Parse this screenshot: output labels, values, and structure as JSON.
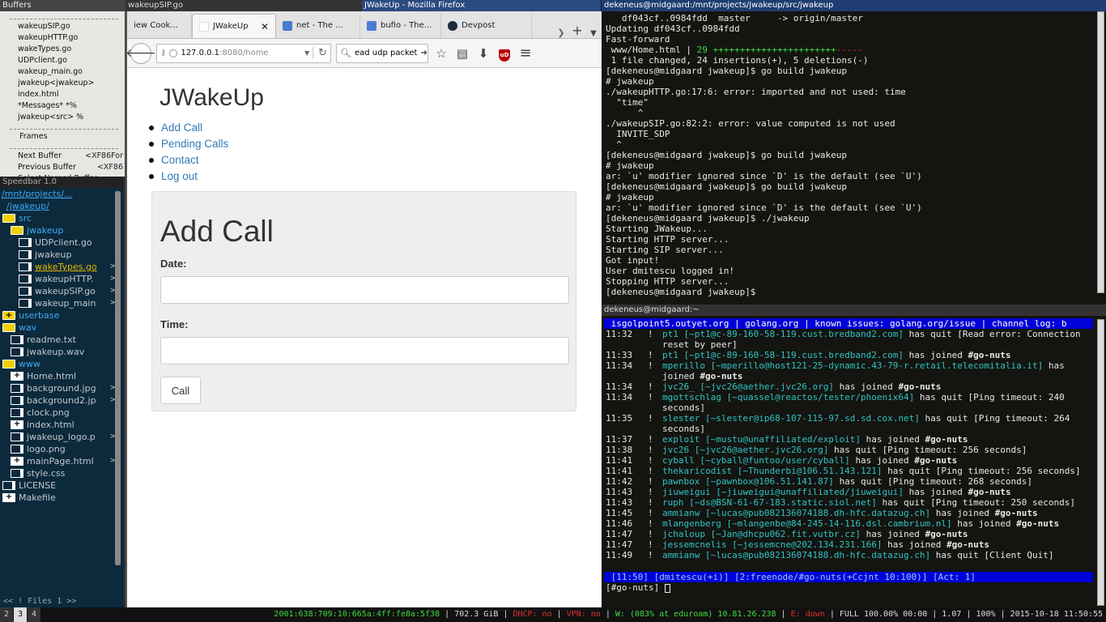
{
  "buffers": {
    "title": "Buffers",
    "items": [
      "wakeupSIP.go",
      "wakeupHTTP.go",
      "wakeTypes.go",
      "UDPclient.go",
      "wakeup_main.go",
      "jwakeup<jwakeup>",
      "index.html",
      "*Messages* *%",
      "jwakeup<src> %"
    ],
    "frames_label": "Frames",
    "commands": [
      {
        "label": "Next Buffer",
        "key": "<XF86For"
      },
      {
        "label": "Previous Buffer",
        "key": "<XF86"
      },
      {
        "label": "Select Named Buffer",
        "key": ""
      }
    ]
  },
  "speedbar": {
    "title": "Speedbar 1.0",
    "path1": "/mnt/projects/...",
    "path2": "/jwakeup/",
    "rows": [
      {
        "indent": 0,
        "icon": "folder",
        "label": "src",
        "cls": "dir"
      },
      {
        "indent": 1,
        "icon": "folder",
        "label": "jwakeup",
        "cls": "dir"
      },
      {
        "indent": 2,
        "icon": "file",
        "label": "UDPclient.go",
        "cls": ""
      },
      {
        "indent": 2,
        "icon": "file",
        "label": "jwakeup",
        "cls": ""
      },
      {
        "indent": 2,
        "icon": "file",
        "label": "wakeTypes.go",
        "cls": "sel",
        "arrow": ">"
      },
      {
        "indent": 2,
        "icon": "file",
        "label": "wakeupHTTP.",
        "cls": "",
        "arrow": ">"
      },
      {
        "indent": 2,
        "icon": "file",
        "label": "wakeupSIP.go",
        "cls": "",
        "arrow": ">"
      },
      {
        "indent": 2,
        "icon": "file",
        "label": "wakeup_main",
        "cls": "",
        "arrow": ">"
      },
      {
        "indent": 0,
        "icon": "folderplus",
        "label": "userbase",
        "cls": "dir"
      },
      {
        "indent": 0,
        "icon": "folder",
        "label": "wav",
        "cls": "dir"
      },
      {
        "indent": 1,
        "icon": "file",
        "label": "readme.txt",
        "cls": ""
      },
      {
        "indent": 1,
        "icon": "file",
        "label": "jwakeup.wav",
        "cls": ""
      },
      {
        "indent": 0,
        "icon": "folder",
        "label": "www",
        "cls": "dir"
      },
      {
        "indent": 1,
        "icon": "fileplus",
        "label": "Home.html",
        "cls": ""
      },
      {
        "indent": 1,
        "icon": "file",
        "label": "background.jpg",
        "cls": "",
        "arrow": ">"
      },
      {
        "indent": 1,
        "icon": "file",
        "label": "background2.jp",
        "cls": "",
        "arrow": ">"
      },
      {
        "indent": 1,
        "icon": "file",
        "label": "clock.png",
        "cls": ""
      },
      {
        "indent": 1,
        "icon": "fileplus",
        "label": "index.html",
        "cls": ""
      },
      {
        "indent": 1,
        "icon": "file",
        "label": "jwakeup_logo.p",
        "cls": "",
        "arrow": ">"
      },
      {
        "indent": 1,
        "icon": "file",
        "label": "logo.png",
        "cls": ""
      },
      {
        "indent": 1,
        "icon": "fileplus",
        "label": "mainPage.html",
        "cls": "",
        "arrow": ">"
      },
      {
        "indent": 1,
        "icon": "file",
        "label": "style.css",
        "cls": ""
      },
      {
        "indent": 0,
        "icon": "file",
        "label": "LICENSE",
        "cls": ""
      },
      {
        "indent": 0,
        "icon": "fileplus",
        "label": "Makefile",
        "cls": ""
      }
    ],
    "footer": "<< ! Files   1 >>"
  },
  "firefox": {
    "left_title": "wakeupSIP.go",
    "window_title": "JWakeUp - Mozilla Firefox",
    "tabs": [
      {
        "label": "iew Cook..."
      },
      {
        "label": "JWakeUp",
        "active": true
      },
      {
        "label": "net - The ..."
      },
      {
        "label": "bufio - The..."
      },
      {
        "label": "Devpost"
      }
    ],
    "url_host": "127.0.0.1",
    "url_rest": ":8080/home",
    "search_value": "ead udp packet",
    "page": {
      "brand": "JWakeUp",
      "nav": [
        "Add Call",
        "Pending Calls",
        "Contact",
        "Log out"
      ],
      "form_title": "Add Call",
      "date_label": "Date:",
      "time_label": "Time:",
      "date_value": "",
      "time_value": "",
      "submit": "Call"
    }
  },
  "term1": {
    "title": "dekeneus@midgaard:/mnt/projects/jwakeup/src/jwakeup",
    "lines": [
      "   df043cf..0984fdd  master     -> origin/master",
      "Updating df043cf..0984fdd",
      "Fast-forward",
      " www/Home.html | 29 +++++++++++++++++++++++-----",
      " 1 file changed, 24 insertions(+), 5 deletions(-)",
      "[dekeneus@midgaard jwakeup]$ go build jwakeup",
      "# jwakeup",
      "./wakeupHTTP.go:17:6: error: imported and not used: time",
      "  \"time\"",
      "      ^",
      "./wakeupSIP.go:82:2: error: value computed is not used",
      "  INVITE_SDP",
      "  ^",
      "[dekeneus@midgaard jwakeup]$ go build jwakeup",
      "# jwakeup",
      "ar: `u' modifier ignored since `D' is the default (see `U')",
      "[dekeneus@midgaard jwakeup]$ go build jwakeup",
      "# jwakeup",
      "ar: `u' modifier ignored since `D' is the default (see `U')",
      "[dekeneus@midgaard jwakeup]$ ./jwakeup",
      "Starting JWakeup...",
      "Starting HTTP server...",
      "Starting SIP server...",
      "Got input!",
      "User dmitescu logged in!",
      "Stopping HTTP server...",
      "[dekeneus@midgaard jwakeup]$ "
    ]
  },
  "term2": {
    "title": "dekeneus@midgaard:~",
    "topic": " isgolpoint5.outyet.org | golang.org | known issues: golang.org/issue | channel log: b",
    "lines": [
      {
        "t": "11:32",
        "nick": "pt1",
        "host": "[~pt1@c-89-160-58-119.cust.bredband2.com]",
        "action": "has quit",
        "extra": "[Read error: Connection reset by peer]"
      },
      {
        "t": "11:33",
        "nick": "pt1",
        "host": "[~pt1@c-89-160-58-119.cust.bredband2.com]",
        "action": "has joined",
        "extra": "#go-nuts"
      },
      {
        "t": "11:34",
        "nick": "mperillo",
        "host": "[~mperillo@host121-25-dynamic.43-79-r.retail.telecomitalia.it]",
        "action": "has joined",
        "extra": "#go-nuts"
      },
      {
        "t": "11:34",
        "nick": "jvc26_",
        "host": "[~jvc26@aether.jvc26.org]",
        "action": "has joined",
        "extra": "#go-nuts"
      },
      {
        "t": "11:34",
        "nick": "mgottschlag",
        "host": "[~quassel@reactos/tester/phoenix64]",
        "action": "has quit",
        "extra": "[Ping timeout: 240 seconds]"
      },
      {
        "t": "11:35",
        "nick": "slester",
        "host": "[~slester@ip68-107-115-97.sd.sd.cox.net]",
        "action": "has quit",
        "extra": "[Ping timeout: 264 seconds]"
      },
      {
        "t": "11:37",
        "nick": "exploit",
        "host": "[~mustu@unaffiliated/exploit]",
        "action": "has joined",
        "extra": "#go-nuts"
      },
      {
        "t": "11:38",
        "nick": "jvc26",
        "host": "[~jvc26@aether.jvc26.org]",
        "action": "has quit",
        "extra": "[Ping timeout: 256 seconds]"
      },
      {
        "t": "11:41",
        "nick": "cyball",
        "host": "[~cyball@funtoo/user/cyball]",
        "action": "has joined",
        "extra": "#go-nuts"
      },
      {
        "t": "11:41",
        "nick": "thekaricodist",
        "host": "[~Thunderbi@106.51.143.121]",
        "action": "has quit",
        "extra": "[Ping timeout: 256 seconds]"
      },
      {
        "t": "11:42",
        "nick": "pawnbox",
        "host": "[~pawnbox@106.51.141.87]",
        "action": "has quit",
        "extra": "[Ping timeout: 268 seconds]"
      },
      {
        "t": "11:43",
        "nick": "jiuweigui",
        "host": "[~jiuweigui@unaffiliated/jiuweigui]",
        "action": "has joined",
        "extra": "#go-nuts"
      },
      {
        "t": "11:43",
        "nick": "ruph",
        "host": "[~ds@BSN-61-67-183.static.siol.net]",
        "action": "has quit",
        "extra": "[Ping timeout: 250 seconds]"
      },
      {
        "t": "11:45",
        "nick": "ammianw",
        "host": "[~lucas@pub082136074188.dh-hfc.datazug.ch]",
        "action": "has joined",
        "extra": "#go-nuts"
      },
      {
        "t": "11:46",
        "nick": "mlangenberg",
        "host": "[~mlangenbe@84-245-14-116.dsl.cambrium.nl]",
        "action": "has joined",
        "extra": "#go-nuts"
      },
      {
        "t": "11:47",
        "nick": "jchaloup",
        "host": "[~Jan@dhcpu062.fit.vutbr.cz]",
        "action": "has joined",
        "extra": "#go-nuts"
      },
      {
        "t": "11:47",
        "nick": "jessemcnelis",
        "host": "[~jessemcne@202.134.231.166]",
        "action": "has joined",
        "extra": "#go-nuts"
      },
      {
        "t": "11:49",
        "nick": "ammianw",
        "host": "[~lucas@pub082136074188.dh-hfc.datazug.ch]",
        "action": "has quit",
        "extra": "[Client Quit]"
      }
    ],
    "status": " [11:50] [dmitescu(+i)] [2:freenode/#go-nuts(+Ccjnt 10:100)] [Act: 1]",
    "prompt": "[#go-nuts] "
  },
  "bottombar": {
    "workspaces": [
      "2",
      "3",
      "4"
    ],
    "active_ws": "3",
    "ipv6": "2001:638:709:10:665a:4ff:fe8a:5f38",
    "disk": "702.3 GiB",
    "dhcp": "DHCP: no",
    "vpn": "VPN: no",
    "wifi": "W: (083% at eduroam) 10.81.26.238",
    "eth": "E: down",
    "battery": "FULL 100.00% 00:00",
    "load": "1.07",
    "volume": "100%",
    "clock": "2015-10-18 11:50:55",
    "colors": {
      "ok": "#3ddc3d",
      "bad": "#e03030"
    }
  }
}
